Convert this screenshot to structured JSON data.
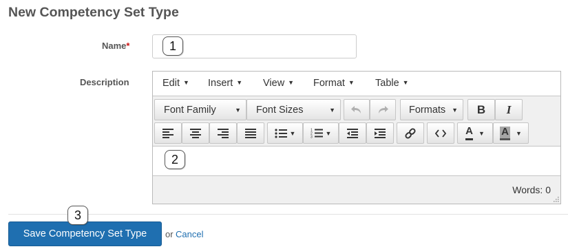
{
  "page": {
    "title": "New Competency Set Type"
  },
  "form": {
    "name_label": "Name",
    "required_marker": "*",
    "name_value": "",
    "description_label": "Description"
  },
  "editor": {
    "menubar": [
      {
        "label": "Edit",
        "caret": "▼"
      },
      {
        "label": "Insert",
        "caret": "▼"
      },
      {
        "label": "View",
        "caret": "▼"
      },
      {
        "label": "Format",
        "caret": "▼"
      },
      {
        "label": "Table",
        "caret": "▼"
      }
    ],
    "font_family_label": "Font Family",
    "font_sizes_label": "Font Sizes",
    "formats_label": "Formats",
    "bold_glyph": "B",
    "italic_glyph": "I",
    "text_color_glyph": "A",
    "bg_color_glyph": "A",
    "caret": "▼",
    "words_status": "Words: 0",
    "icons": {
      "undo": "undo-icon",
      "redo": "redo-icon",
      "align_left": "align-left-icon",
      "align_center": "align-center-icon",
      "align_right": "align-right-icon",
      "align_justify": "align-justify-icon",
      "bullet_list": "bullet-list-icon",
      "numbered_list": "numbered-list-icon",
      "outdent": "outdent-icon",
      "indent": "indent-icon",
      "link": "link-icon",
      "code": "code-icon"
    }
  },
  "annotations": {
    "n1": "1",
    "n2": "2",
    "n3": "3"
  },
  "footer": {
    "save_label": "Save Competency Set Type",
    "or_text": "or",
    "cancel_label": "Cancel"
  },
  "colors": {
    "primary": "#1f6fb0",
    "required": "#cc1111",
    "bg_color_swatch": "#a6a6a6"
  }
}
